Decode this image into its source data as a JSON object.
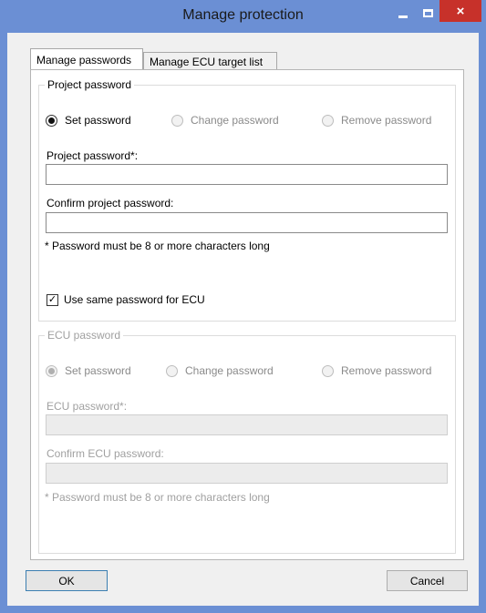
{
  "window": {
    "title": "Manage protection",
    "controls": {
      "minimize": "minimize-icon",
      "maximize": "maximize-icon",
      "close": "×"
    },
    "colors": {
      "frame": "#6b8fd4",
      "close": "#c7312a"
    }
  },
  "tabs": [
    {
      "label": "Manage passwords",
      "active": true
    },
    {
      "label": "Manage ECU target list",
      "active": false
    }
  ],
  "project": {
    "title": "Project password",
    "options": [
      "Set password",
      "Change password",
      "Remove password"
    ],
    "selected": "Set password",
    "password_label": "Project password*:",
    "password_value": "",
    "confirm_label": "Confirm project password:",
    "confirm_value": "",
    "hint": "* Password must be 8 or more characters long",
    "same_for_ecu_label": "Use same password for ECU",
    "same_for_ecu_checked": true
  },
  "ecu": {
    "title": "ECU password",
    "options": [
      "Set password",
      "Change password",
      "Remove password"
    ],
    "selected": "Set password",
    "password_label": "ECU password*:",
    "password_value": "",
    "confirm_label": "Confirm ECU password:",
    "confirm_value": "",
    "hint": "* Password must be 8 or more characters long"
  },
  "buttons": {
    "ok": "OK",
    "cancel": "Cancel"
  }
}
